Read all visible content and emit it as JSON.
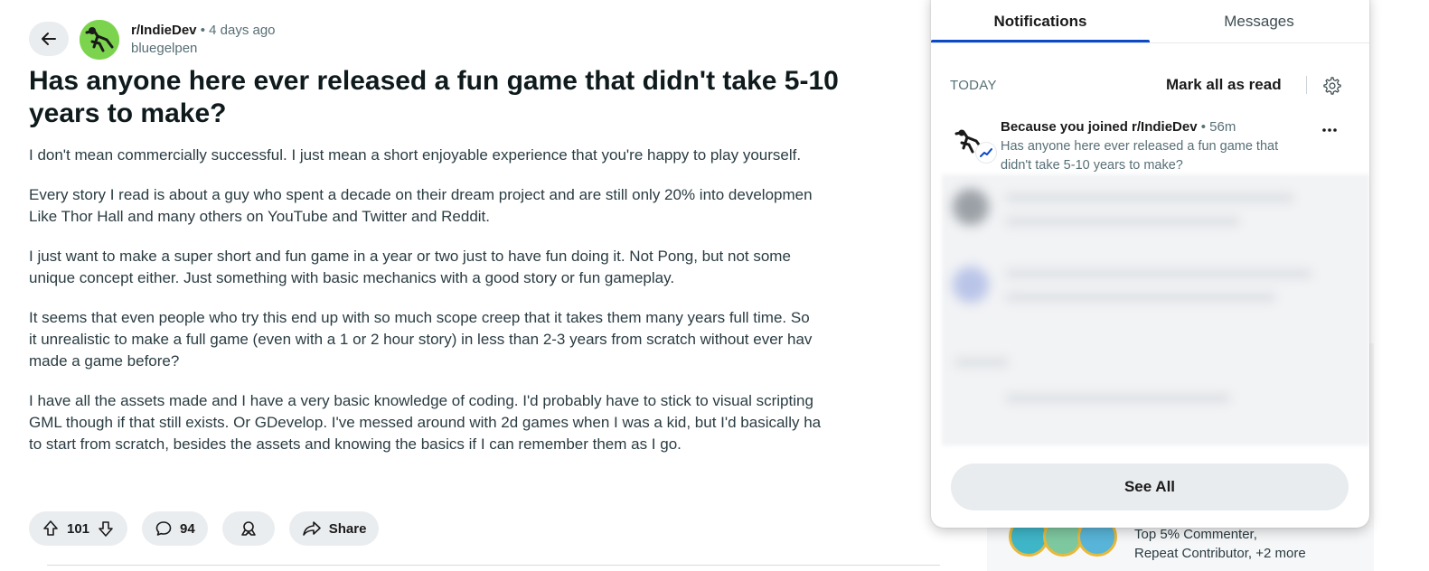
{
  "post": {
    "subreddit": "r/IndieDev",
    "separator": "•",
    "time_ago": "4 days ago",
    "author": "bluegelpen",
    "title_line1": "Has anyone here ever released a fun game that didn't take 5-10",
    "title_line2": "years to make?",
    "paragraphs": [
      [
        "I don't mean commercially successful. I just mean a short enjoyable experience that you're happy to play yourself."
      ],
      [
        "Every story I read is about a guy who spent a decade on their dream project and are still only 20% into developmen",
        "Like Thor Hall and many others on YouTube and Twitter and Reddit."
      ],
      [
        "I just want to make a super short and fun game in a year or two just to have fun doing it. Not Pong, but not some",
        "unique concept either. Just something with basic mechanics with a good story or fun gameplay."
      ],
      [
        "It seems that even people who try this end up with so much scope creep that it takes them many years full time. So",
        "it unrealistic to make a full game (even with a 1 or 2 hour story) in less than 2-3 years from scratch without ever hav",
        "made a game before?"
      ],
      [
        "I have all the assets made and I have a very basic knowledge of coding. I'd probably have to stick to visual scripting",
        "GML though if that still exists. Or GDevelop. I've messed around with 2d games when I was a kid, but I'd basically ha",
        "to start from scratch, besides the assets and knowing the basics if I can remember them as I go."
      ]
    ],
    "vote_count": "101",
    "comment_count": "94",
    "share_label": "Share"
  },
  "sidebar": {
    "achievements_line1": "Top 5% Commenter,",
    "achievements_line2": "Repeat Contributor, +2 more"
  },
  "notifications": {
    "tabs": [
      {
        "label": "Notifications",
        "active": true
      },
      {
        "label": "Messages",
        "active": false
      }
    ],
    "section_label": "TODAY",
    "mark_all_label": "Mark all as read",
    "items": [
      {
        "prefix": "Because you joined ",
        "subreddit": "r/IndieDev",
        "separator": " • ",
        "time_ago": "56m",
        "body": "Has anyone here ever released a fun game that didn't take 5-10 years to make?"
      }
    ],
    "see_all_label": "See All"
  },
  "colors": {
    "accent": "#0b49c8",
    "pill_bg": "#eaedef",
    "subreddit_avatar": "#7cd44e"
  },
  "icons": {
    "back": "arrow-left-icon",
    "upvote": "arrow-up-icon",
    "downvote": "arrow-down-icon",
    "comment": "comment-bubble-icon",
    "award": "award-icon",
    "share": "share-arrow-icon",
    "settings": "gear-icon",
    "more": "more-dots-icon"
  }
}
